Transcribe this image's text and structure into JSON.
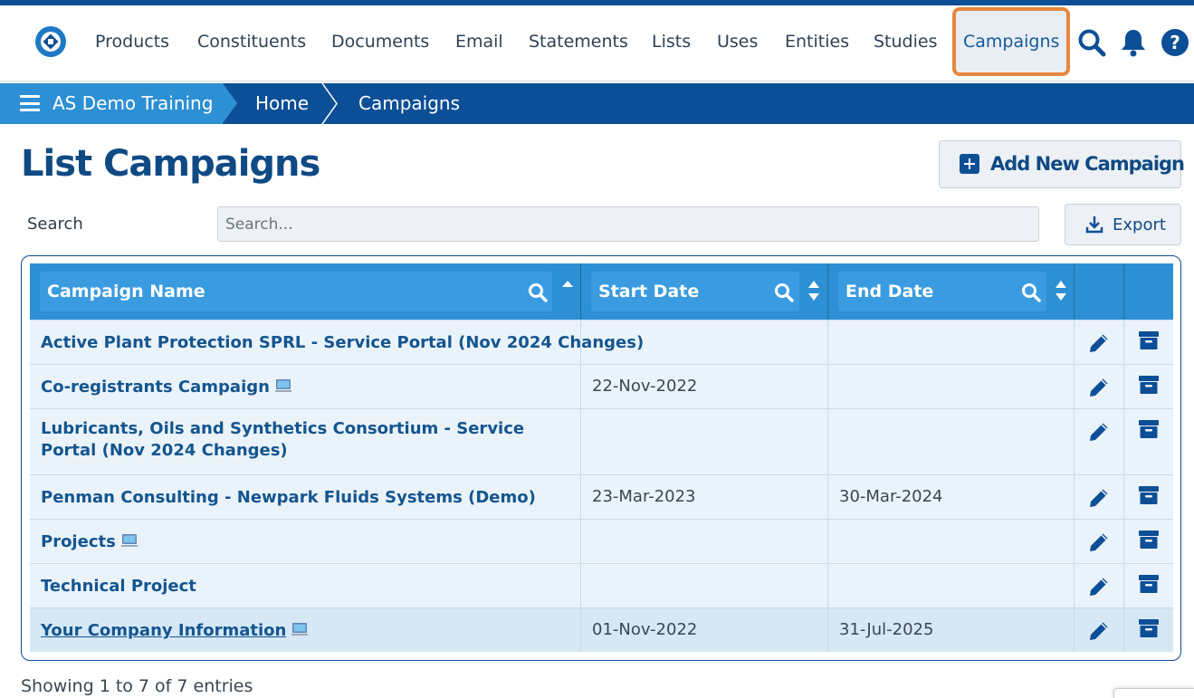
{
  "app": {
    "brand_color": "#0d4f96",
    "accent_color": "#2d8fd4",
    "highlight_color": "#e8873f"
  },
  "nav": {
    "items": [
      {
        "label": "Products"
      },
      {
        "label": "Constituents"
      },
      {
        "label": "Documents"
      },
      {
        "label": "Email"
      },
      {
        "label": "Statements"
      },
      {
        "label": "Lists"
      },
      {
        "label": "Uses"
      },
      {
        "label": "Entities"
      },
      {
        "label": "Studies"
      },
      {
        "label": "Campaigns"
      }
    ],
    "icons": [
      "search-icon",
      "bell-icon",
      "help-icon"
    ]
  },
  "breadcrumb": {
    "items": [
      {
        "label": "AS Demo Training"
      },
      {
        "label": "Home"
      },
      {
        "label": "Campaigns"
      }
    ]
  },
  "page": {
    "title": "List Campaigns",
    "add_button": "Add New Campaign",
    "search_label": "Search",
    "search_placeholder": "Search...",
    "export_button": "Export"
  },
  "table": {
    "columns": [
      {
        "label": "Campaign Name"
      },
      {
        "label": "Start Date"
      },
      {
        "label": "End Date"
      }
    ],
    "rows": [
      {
        "name": "Active Plant Protection SPRL - Service Portal (Nov 2024 Changes)",
        "start": "",
        "end": ""
      },
      {
        "name": "Co-registrants Campaign",
        "start": "22-Nov-2022",
        "end": ""
      },
      {
        "name": "Lubricants, Oils and Synthetics Consortium - Service Portal (Nov 2024 Changes)",
        "start": "",
        "end": ""
      },
      {
        "name": "Penman Consulting - Newpark Fluids Systems (Demo)",
        "start": "23-Mar-2023",
        "end": "30-Mar-2024"
      },
      {
        "name": "Projects",
        "start": "",
        "end": ""
      },
      {
        "name": "Technical Project",
        "start": "",
        "end": ""
      },
      {
        "name": "Your Company Information",
        "start": "01-Nov-2022",
        "end": "31-Jul-2025"
      }
    ]
  },
  "footer": {
    "entries_text": "Showing 1 to 7 of 7 entries"
  }
}
